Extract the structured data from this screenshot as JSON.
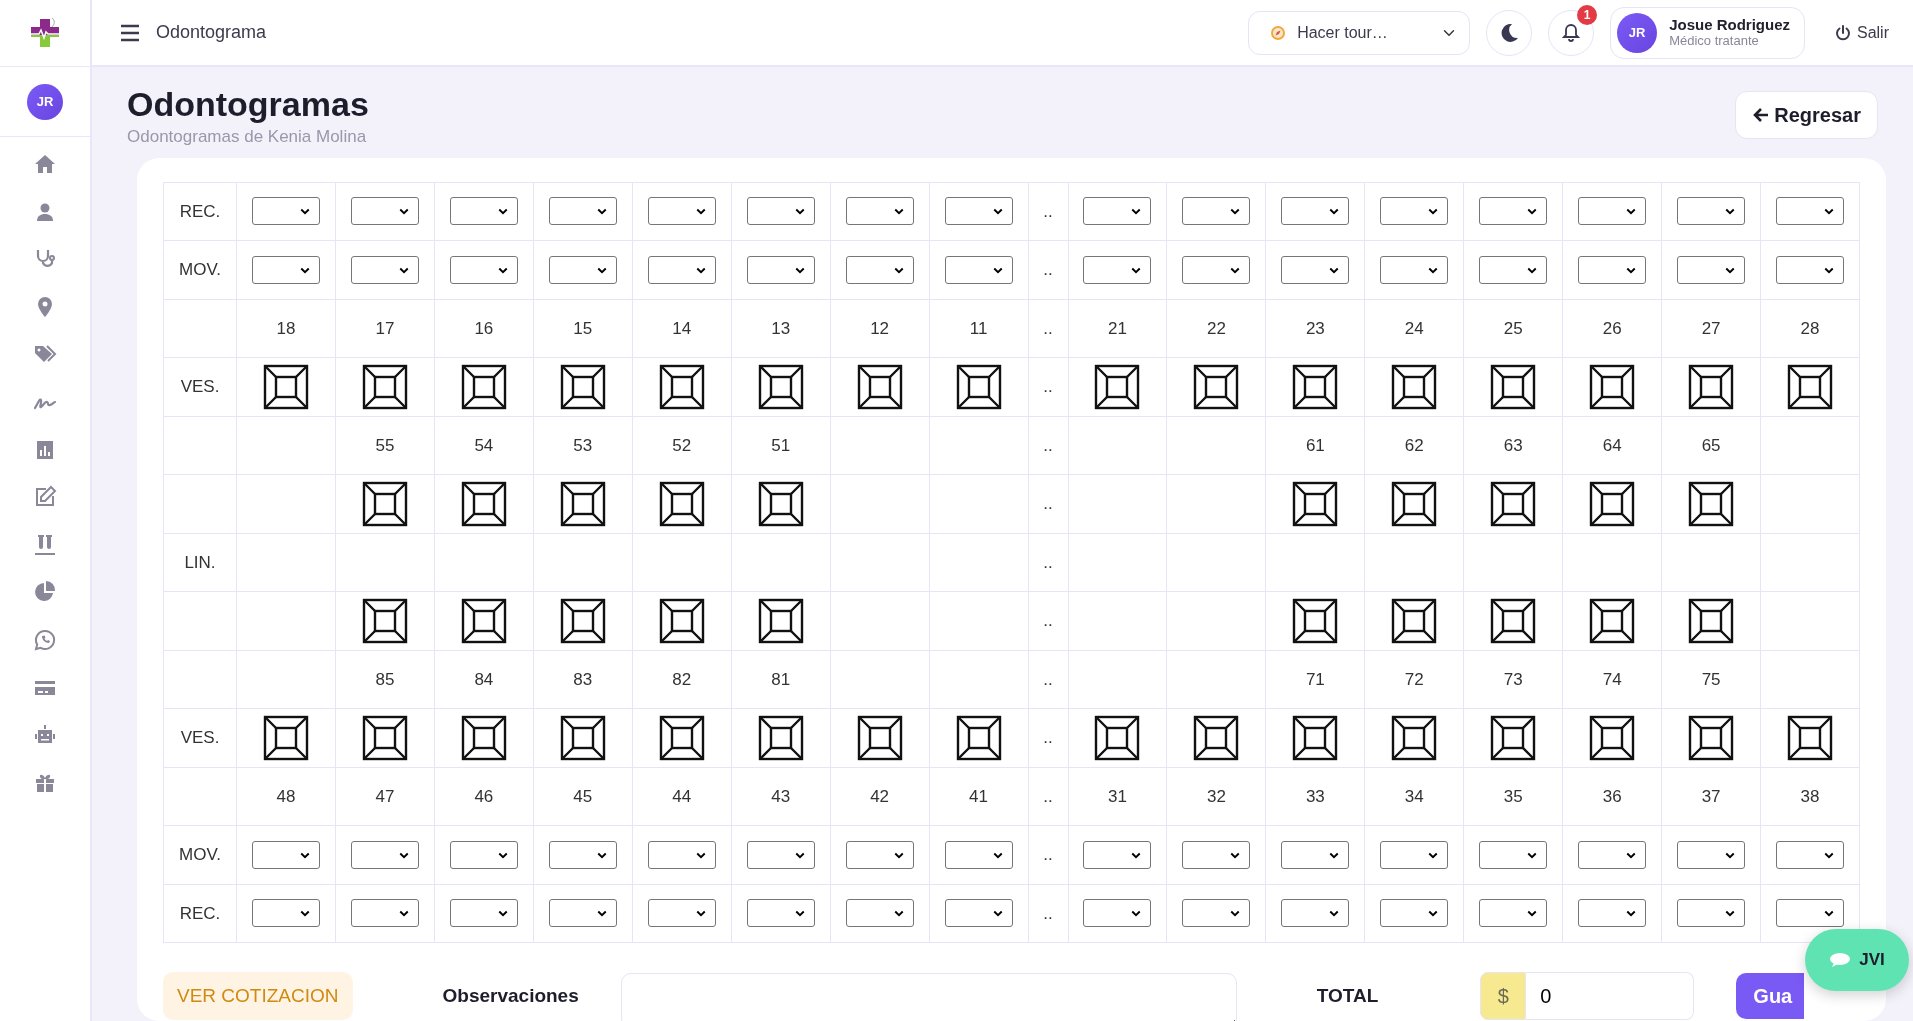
{
  "header": {
    "title": "Odontograma",
    "tour": "Hacer tour…",
    "notifications": "1",
    "user": {
      "initials": "JR",
      "name": "Josue Rodriguez",
      "role": "Médico tratante"
    },
    "logout": "Salir"
  },
  "sidebar": {
    "avatar": "JR"
  },
  "page": {
    "title": "Odontogramas",
    "subtitle": "Odontogramas de Kenia Molina",
    "back_button": "Regresar"
  },
  "odontogram": {
    "rows": [
      {
        "label": "REC.",
        "gap": "..",
        "cells": [
          {
            "kind": "select"
          },
          {
            "kind": "select"
          },
          {
            "kind": "select"
          },
          {
            "kind": "select"
          },
          {
            "kind": "select"
          },
          {
            "kind": "select"
          },
          {
            "kind": "select"
          },
          {
            "kind": "select"
          },
          {
            "kind": "select"
          },
          {
            "kind": "select"
          },
          {
            "kind": "select"
          },
          {
            "kind": "select"
          },
          {
            "kind": "select"
          },
          {
            "kind": "select"
          },
          {
            "kind": "select"
          },
          {
            "kind": "select"
          }
        ]
      },
      {
        "label": "MOV.",
        "gap": "..",
        "cells": [
          {
            "kind": "select"
          },
          {
            "kind": "select"
          },
          {
            "kind": "select"
          },
          {
            "kind": "select"
          },
          {
            "kind": "select"
          },
          {
            "kind": "select"
          },
          {
            "kind": "select"
          },
          {
            "kind": "select"
          },
          {
            "kind": "select"
          },
          {
            "kind": "select"
          },
          {
            "kind": "select"
          },
          {
            "kind": "select"
          },
          {
            "kind": "select"
          },
          {
            "kind": "select"
          },
          {
            "kind": "select"
          },
          {
            "kind": "select"
          }
        ]
      },
      {
        "gap": "..",
        "cells": [
          {
            "kind": "number",
            "text": "18"
          },
          {
            "kind": "number",
            "text": "17"
          },
          {
            "kind": "number",
            "text": "16"
          },
          {
            "kind": "number",
            "text": "15"
          },
          {
            "kind": "number",
            "text": "14"
          },
          {
            "kind": "number",
            "text": "13"
          },
          {
            "kind": "number",
            "text": "12"
          },
          {
            "kind": "number",
            "text": "11"
          },
          {
            "kind": "number",
            "text": "21"
          },
          {
            "kind": "number",
            "text": "22"
          },
          {
            "kind": "number",
            "text": "23"
          },
          {
            "kind": "number",
            "text": "24"
          },
          {
            "kind": "number",
            "text": "25"
          },
          {
            "kind": "number",
            "text": "26"
          },
          {
            "kind": "number",
            "text": "27"
          },
          {
            "kind": "number",
            "text": "28"
          }
        ]
      },
      {
        "label": "VES.",
        "gap": "..",
        "cells": [
          {
            "kind": "tooth"
          },
          {
            "kind": "tooth"
          },
          {
            "kind": "tooth"
          },
          {
            "kind": "tooth"
          },
          {
            "kind": "tooth"
          },
          {
            "kind": "tooth"
          },
          {
            "kind": "tooth"
          },
          {
            "kind": "tooth"
          },
          {
            "kind": "tooth"
          },
          {
            "kind": "tooth"
          },
          {
            "kind": "tooth"
          },
          {
            "kind": "tooth"
          },
          {
            "kind": "tooth"
          },
          {
            "kind": "tooth"
          },
          {
            "kind": "tooth"
          },
          {
            "kind": "tooth"
          }
        ]
      },
      {
        "gap": "..",
        "cells": [
          {
            "kind": "empty"
          },
          {
            "kind": "number",
            "text": "55"
          },
          {
            "kind": "number",
            "text": "54"
          },
          {
            "kind": "number",
            "text": "53"
          },
          {
            "kind": "number",
            "text": "52"
          },
          {
            "kind": "number",
            "text": "51"
          },
          {
            "kind": "empty"
          },
          {
            "kind": "empty"
          },
          {
            "kind": "empty"
          },
          {
            "kind": "empty"
          },
          {
            "kind": "number",
            "text": "61"
          },
          {
            "kind": "number",
            "text": "62"
          },
          {
            "kind": "number",
            "text": "63"
          },
          {
            "kind": "number",
            "text": "64"
          },
          {
            "kind": "number",
            "text": "65"
          },
          {
            "kind": "empty"
          }
        ]
      },
      {
        "gap": "..",
        "cells": [
          {
            "kind": "empty"
          },
          {
            "kind": "tooth"
          },
          {
            "kind": "tooth"
          },
          {
            "kind": "tooth"
          },
          {
            "kind": "tooth"
          },
          {
            "kind": "tooth"
          },
          {
            "kind": "empty"
          },
          {
            "kind": "empty"
          },
          {
            "kind": "empty"
          },
          {
            "kind": "empty"
          },
          {
            "kind": "tooth"
          },
          {
            "kind": "tooth"
          },
          {
            "kind": "tooth"
          },
          {
            "kind": "tooth"
          },
          {
            "kind": "tooth"
          },
          {
            "kind": "empty"
          }
        ]
      },
      {
        "label": "LIN.",
        "gap": "..",
        "cells": [
          {
            "kind": "empty"
          },
          {
            "kind": "empty"
          },
          {
            "kind": "empty"
          },
          {
            "kind": "empty"
          },
          {
            "kind": "empty"
          },
          {
            "kind": "empty"
          },
          {
            "kind": "empty"
          },
          {
            "kind": "empty"
          },
          {
            "kind": "empty"
          },
          {
            "kind": "empty"
          },
          {
            "kind": "empty"
          },
          {
            "kind": "empty"
          },
          {
            "kind": "empty"
          },
          {
            "kind": "empty"
          },
          {
            "kind": "empty"
          },
          {
            "kind": "empty"
          }
        ]
      },
      {
        "gap": "..",
        "cells": [
          {
            "kind": "empty"
          },
          {
            "kind": "tooth"
          },
          {
            "kind": "tooth"
          },
          {
            "kind": "tooth"
          },
          {
            "kind": "tooth"
          },
          {
            "kind": "tooth"
          },
          {
            "kind": "empty"
          },
          {
            "kind": "empty"
          },
          {
            "kind": "empty"
          },
          {
            "kind": "empty"
          },
          {
            "kind": "tooth"
          },
          {
            "kind": "tooth"
          },
          {
            "kind": "tooth"
          },
          {
            "kind": "tooth"
          },
          {
            "kind": "tooth"
          },
          {
            "kind": "empty"
          }
        ]
      },
      {
        "gap": "..",
        "cells": [
          {
            "kind": "empty"
          },
          {
            "kind": "number",
            "text": "85"
          },
          {
            "kind": "number",
            "text": "84"
          },
          {
            "kind": "number",
            "text": "83"
          },
          {
            "kind": "number",
            "text": "82"
          },
          {
            "kind": "number",
            "text": "81"
          },
          {
            "kind": "empty"
          },
          {
            "kind": "empty"
          },
          {
            "kind": "empty"
          },
          {
            "kind": "empty"
          },
          {
            "kind": "number",
            "text": "71"
          },
          {
            "kind": "number",
            "text": "72"
          },
          {
            "kind": "number",
            "text": "73"
          },
          {
            "kind": "number",
            "text": "74"
          },
          {
            "kind": "number",
            "text": "75"
          },
          {
            "kind": "empty"
          }
        ]
      },
      {
        "label": "VES.",
        "gap": "..",
        "cells": [
          {
            "kind": "tooth"
          },
          {
            "kind": "tooth"
          },
          {
            "kind": "tooth"
          },
          {
            "kind": "tooth"
          },
          {
            "kind": "tooth"
          },
          {
            "kind": "tooth"
          },
          {
            "kind": "tooth"
          },
          {
            "kind": "tooth"
          },
          {
            "kind": "tooth"
          },
          {
            "kind": "tooth"
          },
          {
            "kind": "tooth"
          },
          {
            "kind": "tooth"
          },
          {
            "kind": "tooth"
          },
          {
            "kind": "tooth"
          },
          {
            "kind": "tooth"
          },
          {
            "kind": "tooth"
          }
        ]
      },
      {
        "gap": "..",
        "cells": [
          {
            "kind": "number",
            "text": "48"
          },
          {
            "kind": "number",
            "text": "47"
          },
          {
            "kind": "number",
            "text": "46"
          },
          {
            "kind": "number",
            "text": "45"
          },
          {
            "kind": "number",
            "text": "44"
          },
          {
            "kind": "number",
            "text": "43"
          },
          {
            "kind": "number",
            "text": "42"
          },
          {
            "kind": "number",
            "text": "41"
          },
          {
            "kind": "number",
            "text": "31"
          },
          {
            "kind": "number",
            "text": "32"
          },
          {
            "kind": "number",
            "text": "33"
          },
          {
            "kind": "number",
            "text": "34"
          },
          {
            "kind": "number",
            "text": "35"
          },
          {
            "kind": "number",
            "text": "36"
          },
          {
            "kind": "number",
            "text": "37"
          },
          {
            "kind": "number",
            "text": "38"
          }
        ]
      },
      {
        "label": "MOV.",
        "gap": "..",
        "cells": [
          {
            "kind": "select"
          },
          {
            "kind": "select"
          },
          {
            "kind": "select"
          },
          {
            "kind": "select"
          },
          {
            "kind": "select"
          },
          {
            "kind": "select"
          },
          {
            "kind": "select"
          },
          {
            "kind": "select"
          },
          {
            "kind": "select"
          },
          {
            "kind": "select"
          },
          {
            "kind": "select"
          },
          {
            "kind": "select"
          },
          {
            "kind": "select"
          },
          {
            "kind": "select"
          },
          {
            "kind": "select"
          },
          {
            "kind": "select"
          }
        ]
      },
      {
        "label": "REC.",
        "gap": "..",
        "cells": [
          {
            "kind": "select"
          },
          {
            "kind": "select"
          },
          {
            "kind": "select"
          },
          {
            "kind": "select"
          },
          {
            "kind": "select"
          },
          {
            "kind": "select"
          },
          {
            "kind": "select"
          },
          {
            "kind": "select"
          },
          {
            "kind": "select"
          },
          {
            "kind": "select"
          },
          {
            "kind": "select"
          },
          {
            "kind": "select"
          },
          {
            "kind": "select"
          },
          {
            "kind": "select"
          },
          {
            "kind": "select"
          },
          {
            "kind": "select"
          }
        ]
      }
    ]
  },
  "footer": {
    "quote_button": "VER COTIZACION",
    "observations_label": "Observaciones",
    "total_label": "TOTAL",
    "currency": "$",
    "total_value": "0",
    "save_button": "Gua"
  },
  "chat_button": "JVI"
}
